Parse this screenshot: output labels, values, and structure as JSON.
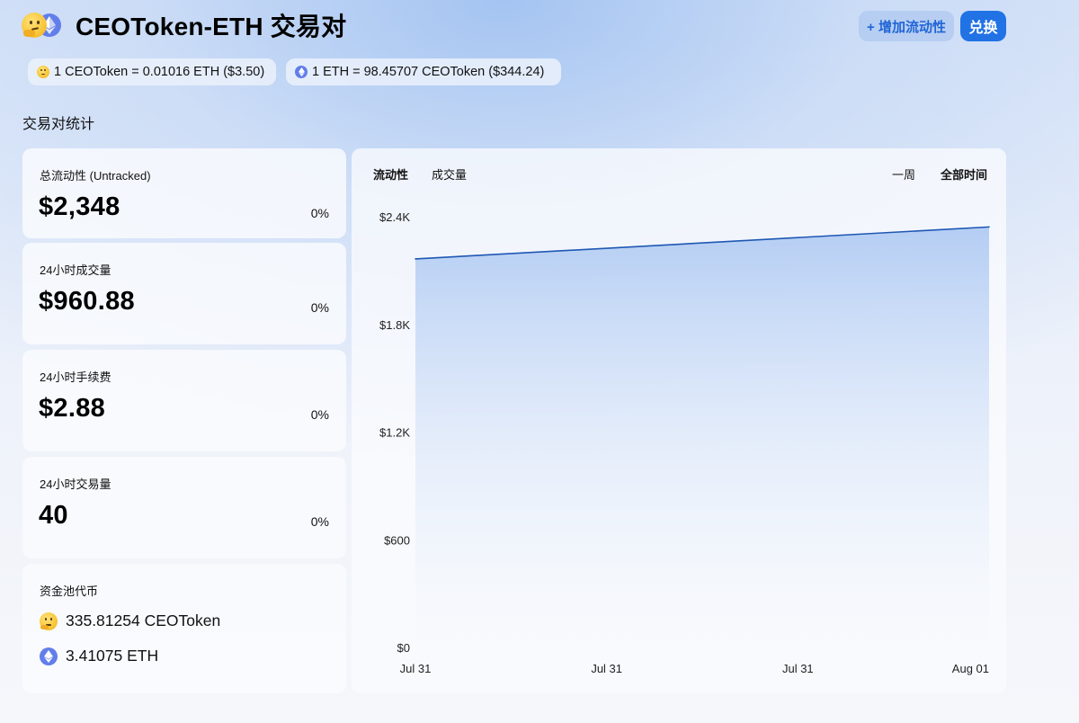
{
  "header": {
    "title": "CEOToken-ETH 交易对",
    "add_liquidity_label": "+ 增加流动性",
    "swap_label": "兑换"
  },
  "rates": [
    {
      "text": "1 CEOToken = 0.01016 ETH ($3.50)",
      "icon": "thinking-face-icon"
    },
    {
      "text": "1 ETH = 98.45707 CEOToken ($344.24)",
      "icon": "eth-icon"
    }
  ],
  "stats_title": "交易对统计",
  "stats": [
    {
      "label": "总流动性 (Untracked)",
      "value": "$2,348",
      "change": "0%"
    },
    {
      "label": "24小时成交量",
      "value": "$960.88",
      "change": "0%"
    },
    {
      "label": "24小时手续费",
      "value": "$2.88",
      "change": "0%"
    },
    {
      "label": "24小时交易量",
      "value": "40",
      "change": "0%"
    }
  ],
  "pool": {
    "label": "资金池代币",
    "tokens": [
      {
        "amount": "335.81254 CEOToken",
        "icon": "thinking-face-icon"
      },
      {
        "amount": "3.41075 ETH",
        "icon": "eth-icon"
      }
    ]
  },
  "chart_tabs": {
    "liquidity": "流动性",
    "volume": "成交量",
    "week": "一周",
    "all_time": "全部时间"
  },
  "colors": {
    "accent": "#2172e5",
    "line": "#1f57b3",
    "eth": "#627eea"
  },
  "chart_data": {
    "type": "area",
    "title": "",
    "xlabel": "",
    "ylabel": "",
    "x": [
      "Jul 31",
      "Aug 01"
    ],
    "x_ticks": [
      "Jul 31",
      "Jul 31",
      "Jul 31",
      "Aug 01"
    ],
    "y_ticks": [
      "$2.4K",
      "$1.8K",
      "$1.2K",
      "$600",
      "$0"
    ],
    "ylim": [
      0,
      2400
    ],
    "series": [
      {
        "values": [
          2170,
          2348
        ]
      }
    ],
    "grid": false,
    "legend": "none"
  }
}
